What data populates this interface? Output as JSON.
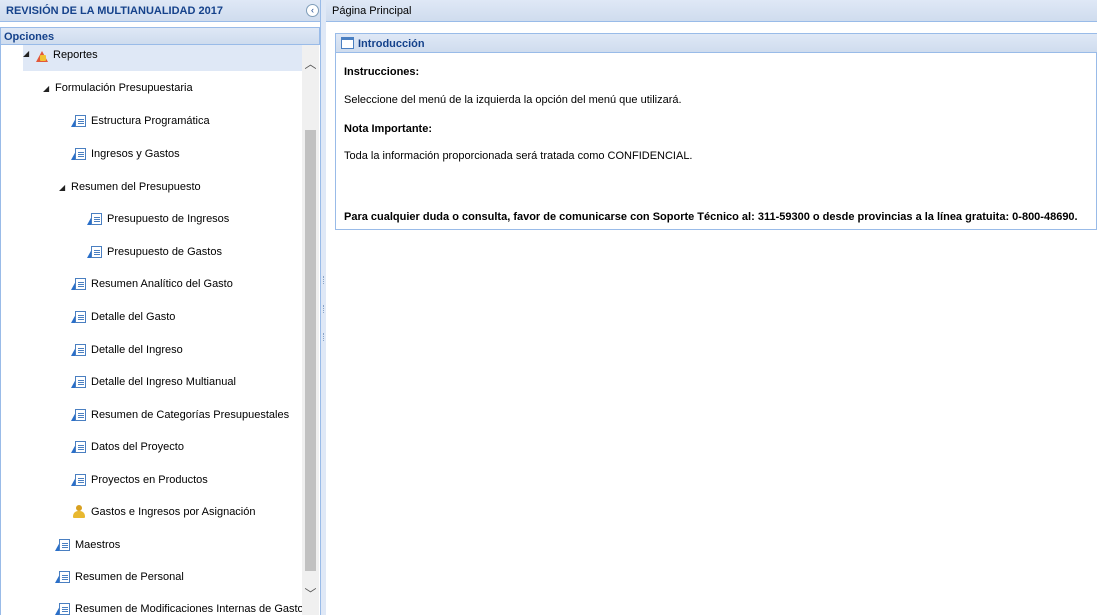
{
  "left_panel": {
    "title": "REVISIÓN DE LA MULTIANUALIDAD 2017",
    "collapse_glyph": "‹",
    "opciones_title": "Opciones"
  },
  "tree": {
    "reportes": "Reportes",
    "formulacion": "Formulación Presupuestaria",
    "estructura": "Estructura Programática",
    "ingresos_gastos": "Ingresos y Gastos",
    "resumen_presupuesto": "Resumen del Presupuesto",
    "presupuesto_ingresos": "Presupuesto de Ingresos",
    "presupuesto_gastos": "Presupuesto de Gastos",
    "resumen_analitico": "Resumen Analítico del Gasto",
    "detalle_gasto": "Detalle del Gasto",
    "detalle_ingreso": "Detalle del Ingreso",
    "detalle_ingreso_multianual": "Detalle del Ingreso Multianual",
    "resumen_categorias": "Resumen de Categorías Presupuestales",
    "datos_proyecto": "Datos del Proyecto",
    "proyectos_productos": "Proyectos en Productos",
    "gastos_ingresos_asignacion": "Gastos e Ingresos por Asignación",
    "maestros": "Maestros",
    "resumen_personal": "Resumen de Personal",
    "resumen_modificaciones": "Resumen de Modificaciones Internas de Gastos"
  },
  "right_panel": {
    "title": "Página Principal"
  },
  "intro": {
    "title": "Introducción",
    "instrucciones_label": "Instrucciones:",
    "instrucciones_text": "Seleccione del menú de la izquierda la opción del menú que utilizará.",
    "nota_label": "Nota Importante:",
    "nota_text": "Toda la información proporcionada será tratada como CONFIDENCIAL.",
    "contacto_text": "Para cualquier duda o consulta, favor de comunicarse con Soporte Técnico al: 311-59300 o desde provincias a la línea gratuita: 0-800-48690."
  },
  "colors": {
    "header_text": "#15428b",
    "border": "#99bbe8",
    "header_bg": "#dfe8f6"
  }
}
